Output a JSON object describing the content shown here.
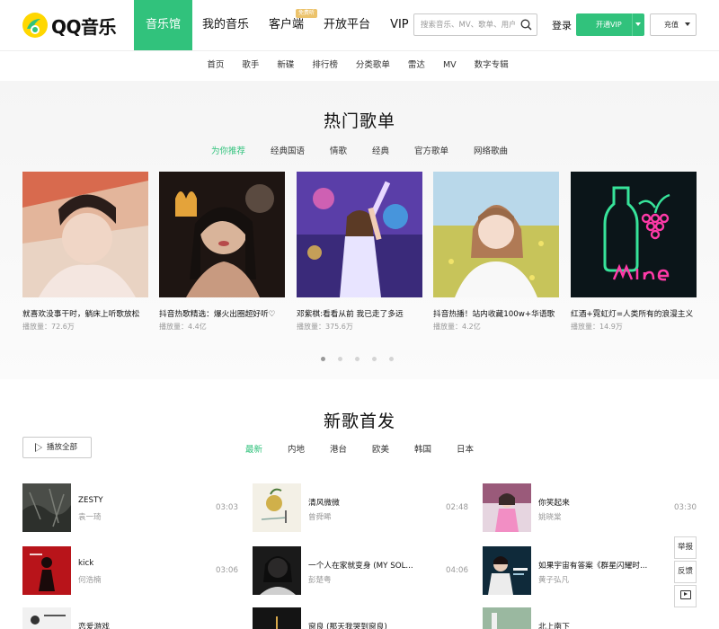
{
  "brand": {
    "name": "QQ音乐",
    "accent": "#31c27c"
  },
  "nav": [
    {
      "label": "音乐馆",
      "active": true
    },
    {
      "label": "我的音乐"
    },
    {
      "label": "客户端",
      "badge": "免费听"
    },
    {
      "label": "开放平台"
    },
    {
      "label": "VIP"
    }
  ],
  "search": {
    "placeholder": "搜索音乐、MV、歌单、用户"
  },
  "header": {
    "login": "登录",
    "vip_button": "开通VIP",
    "charge_button": "充值"
  },
  "subnav": [
    "首页",
    "歌手",
    "新碟",
    "排行榜",
    "分类歌单",
    "雷达",
    "MV",
    "数字专辑"
  ],
  "hot": {
    "title": "热门歌单",
    "tabs": [
      "为你推荐",
      "经典国语",
      "情歌",
      "经典",
      "官方歌单",
      "网络歌曲"
    ],
    "playlists": [
      {
        "title": "就喜欢没事干时，躺床上听歌放松",
        "plays": "播放量：72.6万"
      },
      {
        "title": "抖音热歌精选：爆火出圈超好听♡",
        "plays": "播放量：4.4亿"
      },
      {
        "title": "邓紫棋:看看从前 我已走了多远",
        "plays": "播放量：375.6万"
      },
      {
        "title": "抖音热播！站内收藏100w+华语歌",
        "plays": "播放量：4.2亿"
      },
      {
        "title": "红酒+霓虹灯=人类所有的浪漫主义",
        "plays": "播放量：14.9万"
      }
    ]
  },
  "new_songs": {
    "title": "新歌首发",
    "play_all": "播放全部",
    "tabs": [
      "最新",
      "内地",
      "港台",
      "欧美",
      "韩国",
      "日本"
    ],
    "songs": [
      {
        "name": "ZESTY",
        "artist": "袁一琦",
        "duration": "03:03"
      },
      {
        "name": "清风微微",
        "artist": "曾舜晞",
        "duration": "02:48"
      },
      {
        "name": "你笑起来",
        "artist": "姚晓棠",
        "duration": "03:30"
      },
      {
        "name": "kick",
        "artist": "何浩楠",
        "duration": "03:06"
      },
      {
        "name": "一个人在家就变身 (MY SOL...",
        "artist": "彭楚粤",
        "duration": "04:06"
      },
      {
        "name": "如果宇宙有答案《群星闪耀时...",
        "artist": "黄子弘凡",
        "duration": ""
      },
      {
        "name": "恋爱游戏",
        "artist": "",
        "duration": ""
      },
      {
        "name": "窗良 (那天我哭到窗良)",
        "artist": "",
        "duration": ""
      },
      {
        "name": "北上南下",
        "artist": "",
        "duration": ""
      }
    ]
  },
  "side": {
    "report": "举报",
    "feedback": "反馈"
  }
}
